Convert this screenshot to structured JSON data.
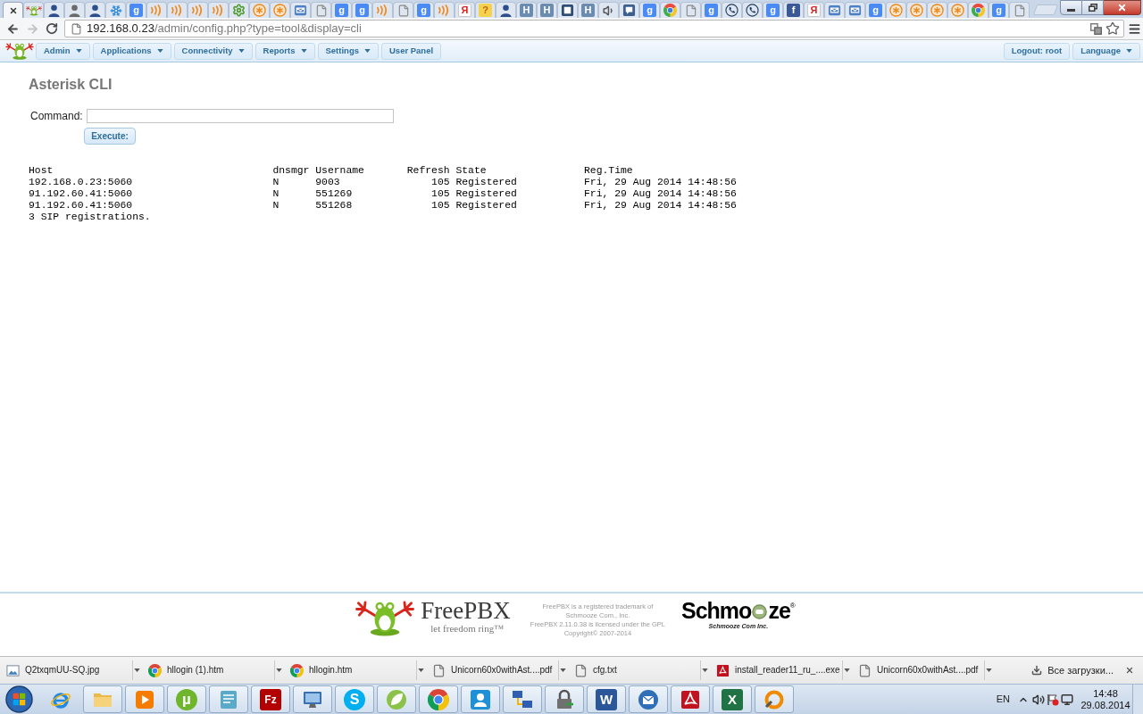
{
  "browser": {
    "tabs": [
      {
        "selected": true
      },
      {
        "kind": "frog",
        "selected": false
      },
      {
        "kind": "person",
        "selected": false
      },
      {
        "kind": "grey-person",
        "selected": false
      },
      {
        "kind": "person",
        "selected": false
      },
      {
        "kind": "snowflake",
        "selected": false
      },
      {
        "kind": "g",
        "glyph": "g",
        "selected": false
      },
      {
        "kind": "rss",
        "selected": false
      },
      {
        "kind": "rss",
        "selected": false
      },
      {
        "kind": "rss",
        "selected": false
      },
      {
        "kind": "rss",
        "selected": false
      },
      {
        "kind": "gear",
        "selected": false
      },
      {
        "kind": "asterisk",
        "selected": false
      },
      {
        "kind": "asterisk",
        "selected": false
      },
      {
        "kind": "mail",
        "selected": false
      },
      {
        "kind": "doc",
        "selected": false
      },
      {
        "kind": "g",
        "glyph": "g",
        "selected": false
      },
      {
        "kind": "g",
        "glyph": "g",
        "selected": false
      },
      {
        "kind": "rss",
        "selected": false
      },
      {
        "kind": "doc",
        "selected": false
      },
      {
        "kind": "g",
        "glyph": "g",
        "selected": false
      },
      {
        "kind": "rss",
        "selected": false
      },
      {
        "kind": "yandex",
        "glyph": "Я",
        "selected": false
      },
      {
        "kind": "question",
        "glyph": "?",
        "selected": false
      },
      {
        "kind": "person",
        "selected": false
      },
      {
        "kind": "h",
        "glyph": "H",
        "selected": false
      },
      {
        "kind": "h",
        "glyph": "H",
        "selected": false
      },
      {
        "kind": "dark-tile",
        "selected": false
      },
      {
        "kind": "h",
        "glyph": "H",
        "selected": false
      },
      {
        "kind": "speaker",
        "selected": false
      },
      {
        "kind": "chat",
        "selected": false
      },
      {
        "kind": "g",
        "glyph": "g",
        "selected": false
      },
      {
        "kind": "globe",
        "selected": false
      },
      {
        "kind": "doc",
        "selected": false
      },
      {
        "kind": "g",
        "glyph": "g",
        "selected": false
      },
      {
        "kind": "phone",
        "selected": false
      },
      {
        "kind": "phone",
        "selected": false
      },
      {
        "kind": "g",
        "glyph": "g",
        "selected": false
      },
      {
        "kind": "facebook",
        "glyph": "f",
        "selected": false
      },
      {
        "kind": "yandex",
        "glyph": "Я",
        "selected": false
      },
      {
        "kind": "mail",
        "selected": false
      },
      {
        "kind": "mail",
        "selected": false
      },
      {
        "kind": "g",
        "glyph": "g",
        "selected": false
      },
      {
        "kind": "asterisk",
        "selected": false
      },
      {
        "kind": "asterisk",
        "selected": false
      },
      {
        "kind": "asterisk",
        "selected": false
      },
      {
        "kind": "asterisk",
        "selected": false
      },
      {
        "kind": "globe",
        "selected": false
      },
      {
        "kind": "g",
        "glyph": "g",
        "selected": false
      },
      {
        "kind": "doc",
        "selected": false
      }
    ],
    "navigation": {
      "back_enabled": true,
      "forward_enabled": false
    },
    "address": {
      "host": "192.168.0.23",
      "path": "/admin/config.php?type=tool&display=cli"
    }
  },
  "nav_menu": {
    "left": [
      {
        "label": "Admin",
        "dropdown": true
      },
      {
        "label": "Applications",
        "dropdown": true
      },
      {
        "label": "Connectivity",
        "dropdown": true
      },
      {
        "label": "Reports",
        "dropdown": true
      },
      {
        "label": "Settings",
        "dropdown": true
      },
      {
        "label": "User Panel",
        "dropdown": false
      }
    ],
    "right": [
      {
        "label": "Logout: root",
        "dropdown": false
      },
      {
        "label": "Language",
        "dropdown": true
      }
    ]
  },
  "page": {
    "title": "Asterisk CLI",
    "command_label": "Command:",
    "execute_button": "Execute:"
  },
  "cli_output": {
    "columns": [
      "Host",
      "dnsmgr",
      "Username",
      "Refresh",
      "State",
      "Reg.Time"
    ],
    "rows": [
      [
        "192.168.0.23:5060",
        "N",
        "9003",
        "105",
        "Registered",
        "Fri, 29 Aug 2014 14:48:56"
      ],
      [
        "91.192.60.41:5060",
        "N",
        "551269",
        "105",
        "Registered",
        "Fri, 29 Aug 2014 14:48:56"
      ],
      [
        "91.192.60.41:5060",
        "N",
        "551268",
        "105",
        "Registered",
        "Fri, 29 Aug 2014 14:48:56"
      ]
    ],
    "summary": "3 SIP registrations."
  },
  "footer": {
    "freepbx_logo": {
      "name": "FreePBX",
      "slogan": "let freedom ring™"
    },
    "notice": [
      "FreePBX is a registered trademark of",
      "Schmooze Com., Inc.",
      "FreePBX 2.11.0.38 is licensed under the GPL",
      "Copyright© 2007-2014"
    ],
    "schmooze_logo": {
      "wordmark_start": "Schmo",
      "wordmark_end": "ze",
      "registered": "®",
      "tagline": "Schmooze Com Inc."
    }
  },
  "downloads": {
    "items": [
      {
        "kind": "image",
        "name": "Q2txqmUU-SQ.jpg"
      },
      {
        "kind": "chrome",
        "name": "hllogin (1).htm"
      },
      {
        "kind": "chrome",
        "name": "hllogin.htm"
      },
      {
        "kind": "file",
        "name": "Unicorn60x0withAst....pdf"
      },
      {
        "kind": "file",
        "name": "cfg.txt"
      },
      {
        "kind": "acrobat",
        "name": "install_reader11_ru_....exe"
      },
      {
        "kind": "file",
        "name": "Unicorn60x0withAst....pdf"
      }
    ],
    "show_all": "Все загрузки..."
  },
  "taskbar": {
    "apps": [
      {
        "kind": "ie",
        "running": false
      },
      {
        "kind": "folder",
        "running": true
      },
      {
        "kind": "media",
        "running": true
      },
      {
        "kind": "utorrent",
        "glyph": "µ",
        "running": true
      },
      {
        "kind": "notepad",
        "running": true
      },
      {
        "kind": "filezilla",
        "glyph": "Fz",
        "running": true
      },
      {
        "kind": "remote",
        "running": true
      },
      {
        "kind": "skype",
        "glyph": "S",
        "running": true
      },
      {
        "kind": "leaf",
        "running": true
      },
      {
        "kind": "chrome",
        "running": true
      },
      {
        "kind": "contacts",
        "running": true
      },
      {
        "kind": "network",
        "running": true
      },
      {
        "kind": "lock",
        "running": true
      },
      {
        "kind": "word",
        "glyph": "W",
        "running": true
      },
      {
        "kind": "thunderbird",
        "running": true
      },
      {
        "kind": "acrobat",
        "running": true
      },
      {
        "kind": "excel",
        "glyph": "X",
        "running": true
      },
      {
        "kind": "ring",
        "running": true
      }
    ],
    "tray": {
      "language": "EN",
      "time": "14:48",
      "date": "29.08.2014"
    }
  }
}
